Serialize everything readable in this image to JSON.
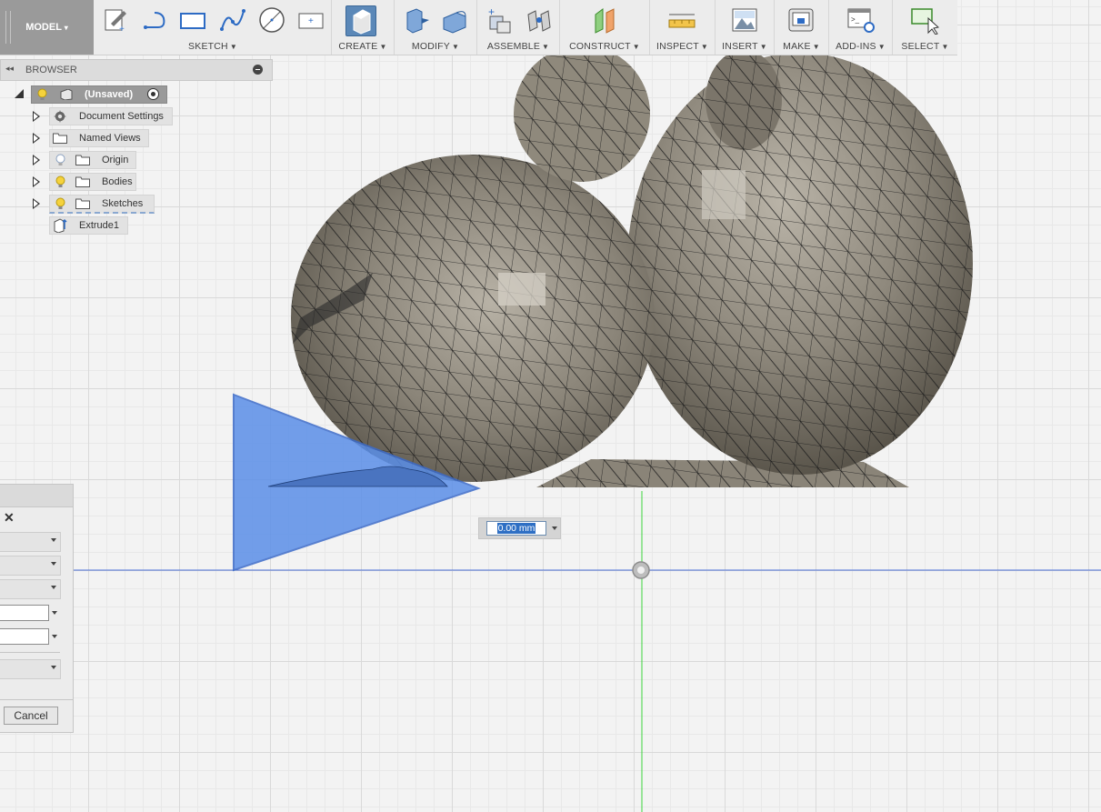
{
  "toolbar": {
    "workspace": "MODEL",
    "groups": [
      {
        "label": "SKETCH"
      },
      {
        "label": "CREATE"
      },
      {
        "label": "MODIFY"
      },
      {
        "label": "ASSEMBLE"
      },
      {
        "label": "CONSTRUCT"
      },
      {
        "label": "INSPECT"
      },
      {
        "label": "INSERT"
      },
      {
        "label": "MAKE"
      },
      {
        "label": "ADD-INS"
      },
      {
        "label": "SELECT"
      }
    ]
  },
  "browser": {
    "title": "BROWSER",
    "root": "(Unsaved)",
    "items": [
      {
        "label": "Document Settings",
        "icon": "gear-icon"
      },
      {
        "label": "Named Views",
        "icon": "folder-icon"
      },
      {
        "label": "Origin",
        "icon": "folder-icon"
      },
      {
        "label": "Bodies",
        "icon": "folder-icon"
      },
      {
        "label": "Sketches",
        "icon": "folder-icon"
      },
      {
        "label": "Extrude1",
        "icon": "extrude-icon"
      }
    ]
  },
  "dialog": {
    "close": "✕",
    "cancel_label": "Cancel"
  },
  "distance_input": {
    "value": "0.00 mm"
  },
  "colors": {
    "accent": "#2e6fc4",
    "plane_fill": "#5b8fe8",
    "mesh_body": "#8e887c"
  }
}
